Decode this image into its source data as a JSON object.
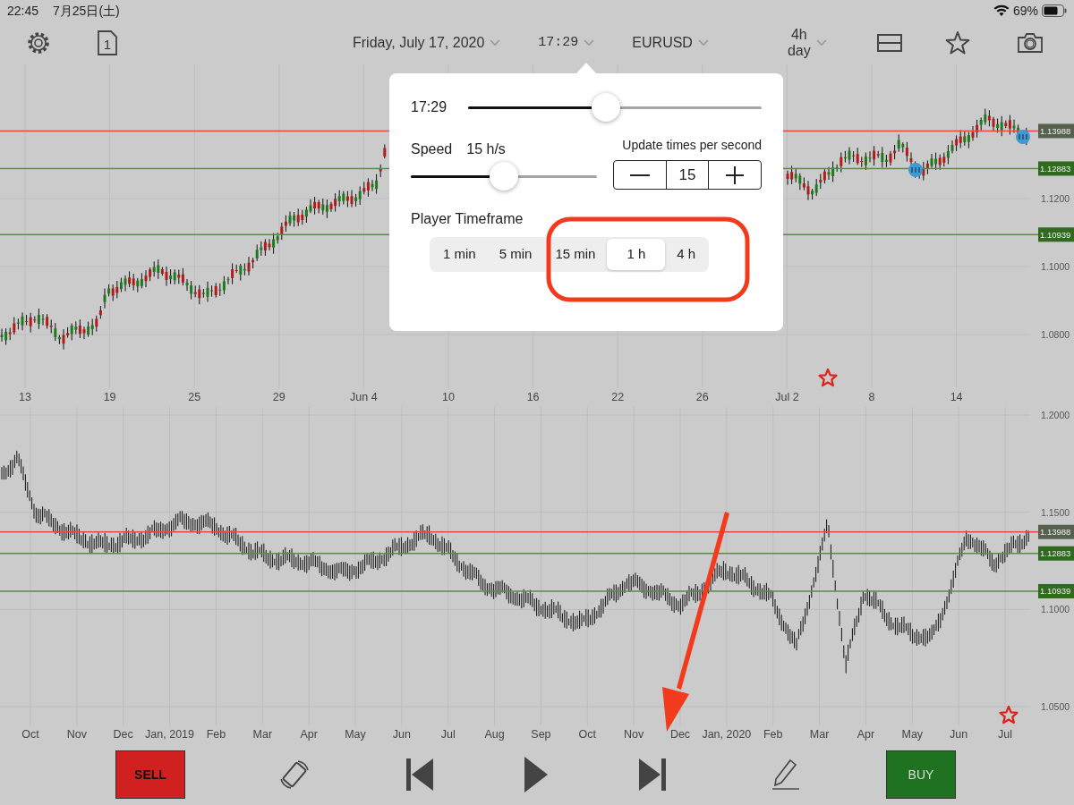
{
  "status_bar": {
    "time": "22:45",
    "date": "7月25日(土)",
    "battery": "69%"
  },
  "toolbar": {
    "page_number": "1",
    "date": "Friday, July 17, 2020",
    "time": "17:29",
    "symbol": "EURUSD",
    "timeframe_top": "4h",
    "timeframe_bottom": "day"
  },
  "player_popover": {
    "time_label": "17:29",
    "time_slider": {
      "level": 0.47
    },
    "speed_label": "Speed",
    "speed_value": "15 h/s",
    "speed_slider": {
      "level": 0.5
    },
    "update_label": "Update times per second",
    "stepper_value": "15",
    "timeframe_label": "Player Timeframe",
    "timeframes": [
      {
        "label": "1 min",
        "selected": false
      },
      {
        "label": "5 min",
        "selected": false
      },
      {
        "label": "15 min",
        "selected": false
      },
      {
        "label": "1 h",
        "selected": true
      },
      {
        "label": "4 h",
        "selected": false
      }
    ]
  },
  "top_chart": {
    "x_labels": [
      "13",
      "19",
      "25",
      "29",
      "Jun 4",
      "10",
      "16",
      "22",
      "26",
      "Jul 2",
      "8",
      "14"
    ],
    "y_labels": [
      {
        "label": "1.1200"
      },
      {
        "label": "1.1000"
      },
      {
        "label": "1.0800"
      }
    ],
    "price_lines": [
      {
        "label": "1.13988",
        "kind": "current",
        "color": "#e8483f"
      },
      {
        "label": "1.12883",
        "kind": "level",
        "color": "#5d8a4a"
      },
      {
        "label": "1.10939",
        "kind": "level",
        "color": "#5d8a4a"
      }
    ]
  },
  "bottom_chart": {
    "x_labels": [
      "Oct",
      "Nov",
      "Dec",
      "Jan, 2019",
      "Feb",
      "Mar",
      "Apr",
      "May",
      "Jun",
      "Jul",
      "Aug",
      "Sep",
      "Oct",
      "Nov",
      "Dec",
      "Jan, 2020",
      "Feb",
      "Mar",
      "Apr",
      "May",
      "Jun",
      "Jul"
    ],
    "y_labels": [
      {
        "label": "1.2000"
      },
      {
        "label": "1.1500"
      },
      {
        "label": "1.1000"
      },
      {
        "label": "1.0500"
      }
    ],
    "price_lines": [
      {
        "label": "1.13988",
        "kind": "current",
        "color": "#e8483f"
      },
      {
        "label": "1.12883",
        "kind": "level",
        "color": "#5d8a4a"
      },
      {
        "label": "1.10939",
        "kind": "level",
        "color": "#5d8a4a"
      }
    ]
  },
  "controls": {
    "sell": "SELL",
    "buy": "BUY"
  }
}
